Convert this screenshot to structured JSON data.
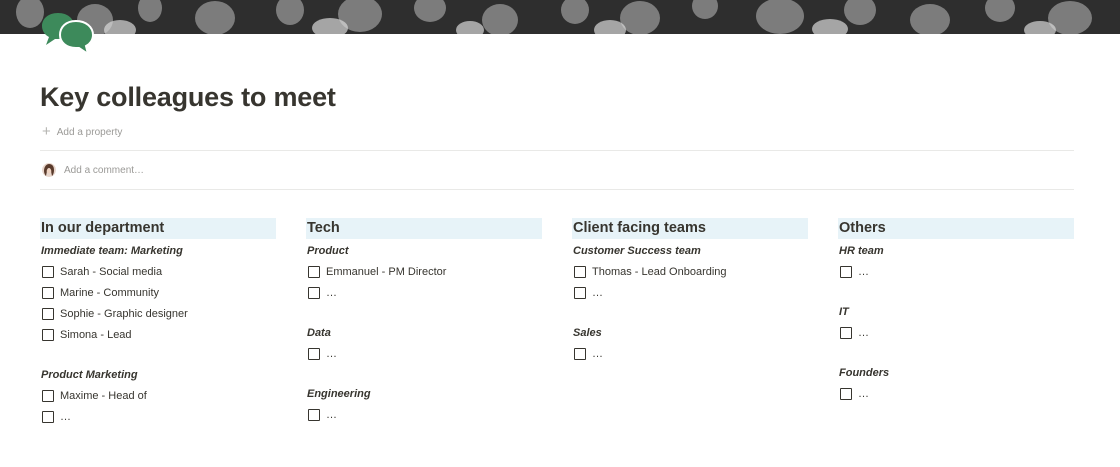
{
  "page": {
    "title": "Key colleagues to meet",
    "add_property": "Add a property",
    "comment_placeholder": "Add a comment…",
    "icon": "speech-bubbles-icon",
    "accent_color": "#3d8a5b",
    "header_highlight": "#e7f3f8"
  },
  "columns": [
    {
      "heading": "In our department",
      "groups": [
        {
          "title": "Immediate team: Marketing",
          "items": [
            "Sarah - Social media",
            "Marine - Community",
            "Sophie - Graphic designer",
            "Simona - Lead"
          ]
        },
        {
          "title": "Product Marketing",
          "items": [
            "Maxime - Head of",
            "…"
          ]
        }
      ]
    },
    {
      "heading": "Tech",
      "groups": [
        {
          "title": "Product",
          "items": [
            "Emmanuel - PM Director",
            "…"
          ]
        },
        {
          "title": "Data",
          "items": [
            "…"
          ]
        },
        {
          "title": "Engineering",
          "items": [
            "…"
          ]
        }
      ]
    },
    {
      "heading": "Client facing teams",
      "groups": [
        {
          "title": "Customer Success team",
          "items": [
            "Thomas - Lead Onboarding",
            "…"
          ]
        },
        {
          "title": "Sales",
          "items": [
            "…"
          ]
        }
      ]
    },
    {
      "heading": "Others",
      "groups": [
        {
          "title": "HR team",
          "items": [
            "…"
          ]
        },
        {
          "title": "IT",
          "items": [
            "…"
          ]
        },
        {
          "title": "Founders",
          "items": [
            "…"
          ]
        }
      ]
    }
  ]
}
